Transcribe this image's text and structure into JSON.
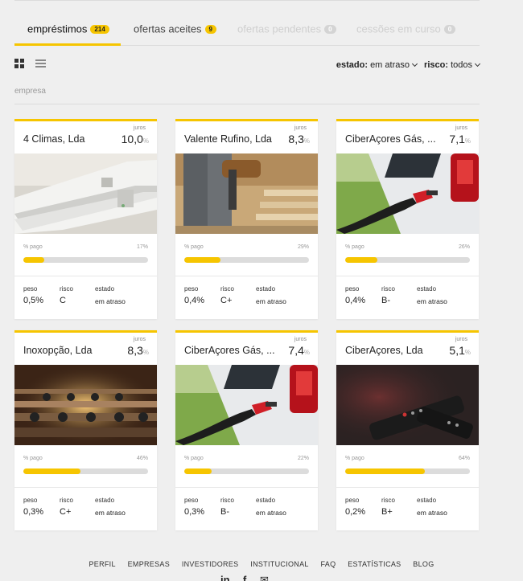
{
  "tabs": [
    {
      "label": "empréstimos",
      "count": "214"
    },
    {
      "label": "ofertas aceites",
      "count": "9"
    },
    {
      "label": "ofertas pendentes",
      "count": "0"
    },
    {
      "label": "cessões em curso",
      "count": "0"
    }
  ],
  "filters": {
    "estado_label": "estado:",
    "estado_value": "em atraso",
    "risco_label": "risco:",
    "risco_value": "todos"
  },
  "section_label": "empresa",
  "card_labels": {
    "juros": "juros",
    "paid": "% pago",
    "peso": "peso",
    "risco": "risco",
    "estado": "estado",
    "pct": "%"
  },
  "cards": [
    {
      "name": "4 Climas, Lda",
      "juros": "10,0",
      "paid": "17%",
      "paid_fraction": 0.17,
      "peso": "0,5%",
      "risco": "C",
      "estado": "em atraso",
      "image": "air-conditioner"
    },
    {
      "name": "Valente Rufino, Lda",
      "juros": "8,3",
      "paid": "29%",
      "paid_fraction": 0.29,
      "peso": "0,4%",
      "risco": "C+",
      "estado": "em atraso",
      "image": "construction-worker"
    },
    {
      "name": "CiberAçores Gás, ...",
      "juros": "7,1",
      "paid": "26%",
      "paid_fraction": 0.26,
      "peso": "0,4%",
      "risco": "B-",
      "estado": "em atraso",
      "image": "fuel-nozzle"
    },
    {
      "name": "Inoxopção, Lda",
      "juros": "8,3",
      "paid": "46%",
      "paid_fraction": 0.46,
      "peso": "0,3%",
      "risco": "C+",
      "estado": "em atraso",
      "image": "metal-pipes"
    },
    {
      "name": "CiberAçores Gás, ...",
      "juros": "7,4",
      "paid": "22%",
      "paid_fraction": 0.22,
      "peso": "0,3%",
      "risco": "B-",
      "estado": "em atraso",
      "image": "fuel-nozzle"
    },
    {
      "name": "CiberAçores, Lda",
      "juros": "5,1",
      "paid": "64%",
      "paid_fraction": 0.64,
      "peso": "0,2%",
      "risco": "B+",
      "estado": "em atraso",
      "image": "tv-remote"
    }
  ],
  "footer": {
    "links": [
      "PERFIL",
      "EMPRESAS",
      "INVESTIDORES",
      "INSTITUCIONAL",
      "FAQ",
      "ESTATÍSTICAS",
      "BLOG"
    ],
    "social": [
      "linkedin-icon",
      "facebook-icon",
      "email-icon"
    ]
  },
  "colors": {
    "accent": "#f6c500",
    "background": "#efefef"
  }
}
